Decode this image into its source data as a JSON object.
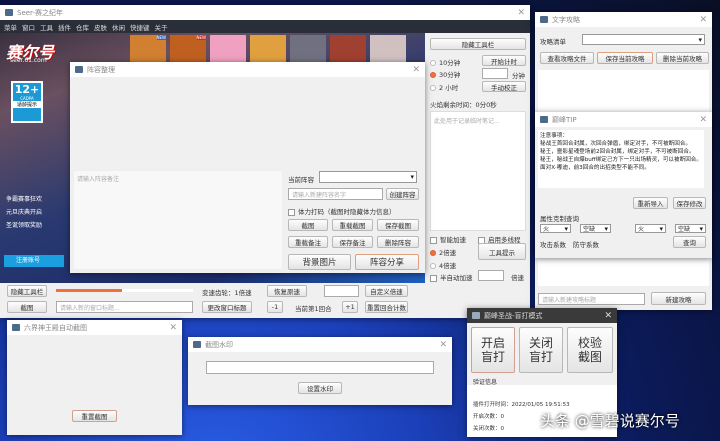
{
  "main": {
    "title": "Seer-赛之纪年",
    "menu": [
      "菜单",
      "窗口",
      "工具",
      "插件",
      "仓库",
      "皮肤",
      "休闲",
      "快捷键",
      "关于"
    ],
    "logo": "赛尔号",
    "logo_url": "seer.61.com",
    "age_rating": "12+",
    "age_org": "CADPA",
    "age_tip": "适龄提示",
    "promos": [
      "争霸赛事狂欢",
      "元旦庆典开启",
      "圣诞领取奖励"
    ],
    "register": "注册账号",
    "games_new": [
      "NEW",
      "NEW"
    ],
    "side": {
      "hide_toolbar": "隐藏工具栏",
      "opt_10": "10分钟",
      "opt_30": "30分钟",
      "opt_2h": "2 小时",
      "start_timer": "开始计时",
      "minutes": "分钟",
      "manual_fix": "手动校正",
      "fire_remaining": "火焰剩余时间：0分0秒",
      "note_placeholder": "此处用于记录临时笔记...",
      "smart_speed": "智能加速",
      "multi_thread": "启用多线程",
      "speed2": "2倍速",
      "speed4": "4倍速",
      "semi_auto": "半自动加速",
      "times": "倍速",
      "tool_tip": "工具提示"
    },
    "bottom": {
      "hide_toolbar": "隐藏工具栏",
      "progress": 0.48,
      "gear": "变速齿轮：1倍速",
      "restore_speed": "恢复原速",
      "custom_speed": "自定义倍速",
      "screenshot": "截图",
      "title_placeholder": "请输入新的窗口标题...",
      "change_title": "更改窗口标题",
      "minus": "-1",
      "round": "当前第1回合",
      "plus": "+1",
      "reset_round": "重置回合计数"
    }
  },
  "lineup": {
    "title": "阵容整理",
    "note_placeholder": "请输入阵容备注",
    "current": "当前阵容",
    "name_placeholder": "请输入新建阵容名字",
    "create": "创建阵容",
    "stamina": "体力打码（截图时隐藏体力信息）",
    "shot": "截图",
    "reload_shot": "重载截图",
    "save_shot": "保存截图",
    "reload_note": "重载备注",
    "save_note": "保存备注",
    "delete": "删除阵容",
    "bg_image": "背景图片",
    "share": "阵容分享"
  },
  "strategy": {
    "title": "文字攻略",
    "list_label": "攻略清单",
    "view": "查看攻略文件",
    "save": "保存当前攻略",
    "delete": "删除当前攻略",
    "new_placeholder": "请输入新建攻略标题",
    "new": "新建攻略"
  },
  "tip": {
    "title": "巅峰TIP",
    "lines": [
      "注意事项：",
      "秘战王首回合封属，次回合弹盾，绑定对手，不可被断回合。",
      "秘王，噩影星魂登场前2回合封属，绑定对手，不可被断回合。",
      "秘王，秘战王自爆buff绑定己方下一只出场精灵，可以被断回合。",
      "面对X·嘟迪，前3回合的出招类型不能不同。"
    ],
    "reimport": "重新导入",
    "save": "保存修改",
    "type_query": "属性克制查询",
    "sel": [
      "火",
      "空缺",
      "火",
      "空缺"
    ],
    "atk": "攻击系数",
    "def": "防守系数",
    "query": "查询"
  },
  "blind": {
    "title": "巅峰圣战-盲打模式",
    "on": [
      "开启",
      "盲打"
    ],
    "off": [
      "关闭",
      "盲打"
    ],
    "verify": [
      "校验",
      "截图"
    ],
    "info": "验证信息",
    "open_time": "插件打开时间：2022/01/05 19:51:53",
    "open_count": "开启次数：0",
    "close_count": "关闭次数：0"
  },
  "sixking": {
    "title": "六界神王殿自动截图",
    "reset": "重置截图"
  },
  "watermark": {
    "title": "截图水印",
    "set": "设置水印"
  },
  "watermark_text": "头条 @雪碧说赛尔号"
}
